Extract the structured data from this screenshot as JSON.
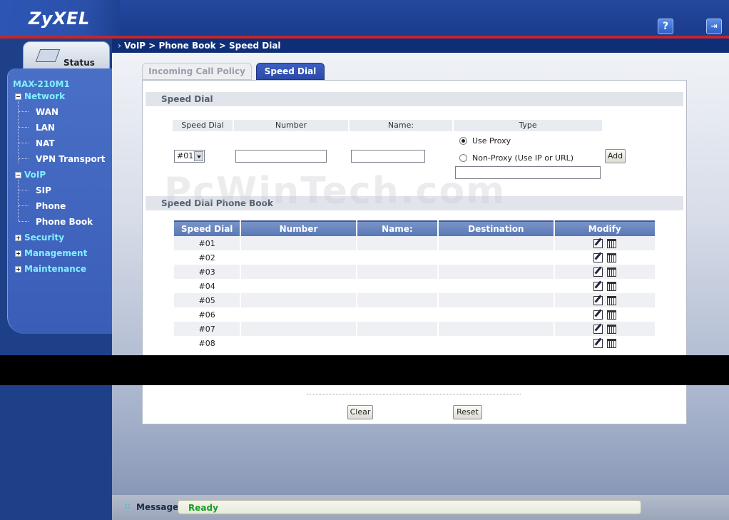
{
  "header": {
    "logo": "ZyXEL",
    "help_icon": "question-mark-icon",
    "help_glyph": "?",
    "logout_icon": "logout-icon",
    "logout_glyph": "⇥"
  },
  "breadcrumb": "VoIP > Phone Book > Speed Dial",
  "sidebar": {
    "status_label": "Status",
    "device_name": "MAX-210M1",
    "groups": [
      {
        "label": "Network",
        "expanded": true,
        "items": [
          "WAN",
          "LAN",
          "NAT",
          "VPN Transport"
        ]
      },
      {
        "label": "VoIP",
        "expanded": true,
        "items": [
          "SIP",
          "Phone",
          "Phone Book"
        ]
      },
      {
        "label": "Security",
        "expanded": false,
        "items": []
      },
      {
        "label": "Management",
        "expanded": false,
        "items": []
      },
      {
        "label": "Maintenance",
        "expanded": false,
        "items": []
      }
    ]
  },
  "tabs": [
    {
      "label": "Incoming Call Policy",
      "active": false
    },
    {
      "label": "Speed Dial",
      "active": true
    }
  ],
  "speed_dial_form": {
    "section_title": "Speed Dial",
    "headers": {
      "speed_dial": "Speed Dial",
      "number": "Number",
      "name": "Name:",
      "type": "Type"
    },
    "selected_speed_dial": "#01",
    "number_value": "",
    "name_value": "",
    "type_options": [
      {
        "label": "Use Proxy",
        "selected": true
      },
      {
        "label": "Non-Proxy (Use IP or URL)",
        "selected": false
      }
    ],
    "non_proxy_value": "",
    "add_label": "Add"
  },
  "phone_book": {
    "section_title": "Speed Dial Phone Book",
    "columns": [
      "Speed Dial",
      "Number",
      "Name:",
      "Destination",
      "Modify"
    ],
    "rows": [
      {
        "speed_dial": "#01",
        "number": "",
        "name": "",
        "destination": ""
      },
      {
        "speed_dial": "#02",
        "number": "",
        "name": "",
        "destination": ""
      },
      {
        "speed_dial": "#03",
        "number": "",
        "name": "",
        "destination": ""
      },
      {
        "speed_dial": "#04",
        "number": "",
        "name": "",
        "destination": ""
      },
      {
        "speed_dial": "#05",
        "number": "",
        "name": "",
        "destination": ""
      },
      {
        "speed_dial": "#06",
        "number": "",
        "name": "",
        "destination": ""
      },
      {
        "speed_dial": "#07",
        "number": "",
        "name": "",
        "destination": ""
      },
      {
        "speed_dial": "#08",
        "number": "",
        "name": "",
        "destination": ""
      }
    ],
    "modify_icons": [
      "edit-icon",
      "delete-icon"
    ]
  },
  "buttons": {
    "clear": "Clear",
    "reset": "Reset"
  },
  "watermark": "PcWinTech.com",
  "message": {
    "label": "Message",
    "text": "Ready",
    "text_color": "#1a9c2a"
  },
  "colors": {
    "accent_blue": "#2c4aa8",
    "header_red": "#c4262e",
    "menu_cyan": "#7ff0ff"
  }
}
